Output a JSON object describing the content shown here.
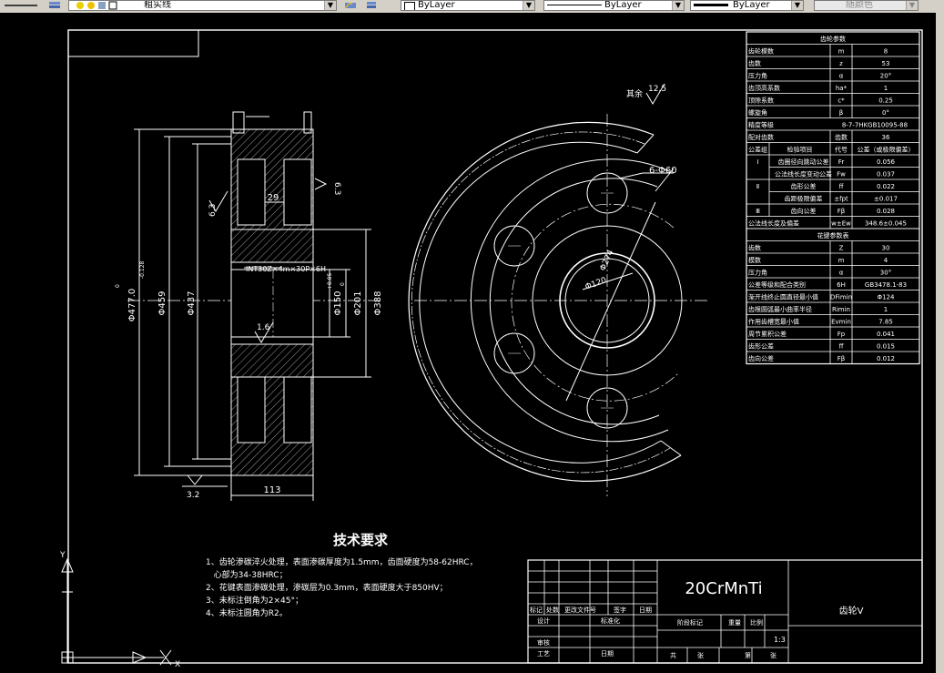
{
  "toolbar": {
    "layer_name": "粗实线",
    "color_combo": "ByLayer",
    "linetype_combo": "ByLayer",
    "lineweight_combo": "ByLayer",
    "plotstyle_combo": "随颜色"
  },
  "drawing": {
    "left_view": {
      "dims_vertical": [
        "Φ477.0",
        "Φ459",
        "Φ437",
        "Φ150",
        "Φ201",
        "Φ388"
      ],
      "tol_upper": "0",
      "tol_lower": "-0.128",
      "tol150_upper": "+0.05",
      "tol150_lower": "0",
      "spline_label": "INT30Z×4m×30P×6H",
      "width_dim": "113",
      "slot_dim": "29",
      "rough_63a": "6.3",
      "rough_63b": "6.3",
      "rough_16": "1.6",
      "rough_32": "3.2"
    },
    "right_view": {
      "holes_label": "6-Φ60",
      "bore_label": "Φ120",
      "pcd_label": "Φ274",
      "rest_label": "其余",
      "rest_rough": "12.5"
    },
    "params_table": {
      "title": "齿轮参数",
      "rows": [
        [
          "齿轮模数",
          "m",
          "8"
        ],
        [
          "齿数",
          "z",
          "53"
        ],
        [
          "压力角",
          "α",
          "20°"
        ],
        [
          "齿顶高系数",
          "ha*",
          "1"
        ],
        [
          "顶隙系数",
          "c*",
          "0.25"
        ],
        [
          "螺旋角",
          "β",
          "0°"
        ],
        [
          "精度等级",
          "",
          "8-7-7HKGB10095-88"
        ],
        [
          "配对齿数",
          "齿数",
          "36"
        ]
      ],
      "check_header": [
        "公差组",
        "检验项目",
        "代号",
        "公差（或极限偏差）"
      ],
      "check_rows": [
        [
          "Ⅰ",
          "齿圈径向跳动公差",
          "Fr",
          "0.056"
        ],
        [
          "",
          "公法线长度变动公差",
          "Fw",
          "0.037"
        ],
        [
          "Ⅱ",
          "齿形公差",
          "ff",
          "0.022"
        ],
        [
          "",
          "齿距极限偏差",
          "±fpt",
          "±0.017"
        ],
        [
          "Ⅲ",
          "齿向公差",
          "Fβ",
          "0.028"
        ],
        [
          "公法线长度及偏差",
          "",
          "w±Ew",
          "348.6±0.045"
        ]
      ],
      "spline_title": "花键参数表",
      "spline_rows": [
        [
          "齿数",
          "Z",
          "30"
        ],
        [
          "模数",
          "m",
          "4"
        ],
        [
          "压力角",
          "α",
          "30°"
        ],
        [
          "公差等级和配合类别",
          "6H",
          "GB3478.1-83"
        ],
        [
          "渐开线终止圆直径最小值",
          "DFimin",
          "Φ124"
        ],
        [
          "齿根圆弧最小曲率半径",
          "Rimin",
          "1"
        ],
        [
          "作用齿槽宽最小值",
          "Evmin",
          "7.85"
        ],
        [
          "周节累积公差",
          "Fp",
          "0.041"
        ],
        [
          "齿形公差",
          "ff",
          "0.015"
        ],
        [
          "齿向公差",
          "Fβ",
          "0.012"
        ]
      ]
    },
    "tech_req": {
      "title": "技术要求",
      "lines": [
        "1、齿轮渗碳淬火处理，表面渗碳厚度为1.5mm，齿面硬度为58-62HRC，",
        "   心部为34-38HRC；",
        "2、花键表面渗碳处理，渗碳层为0.3mm，表面硬度大于850HV；",
        "3、未标注倒角为2×45°；",
        "4、未标注圆角为R2。"
      ]
    },
    "title_block": {
      "material": "20CrMnTi",
      "part_name": "齿轮V",
      "scale": "1:3",
      "labels": [
        "标记",
        "处数",
        "更改文件号",
        "签字",
        "日期",
        "设计",
        "标准化",
        "审核",
        "工艺",
        "日期",
        "阶段标记",
        "重量",
        "比例",
        "共",
        "张",
        "第",
        "张"
      ]
    },
    "ucs": {
      "x_label": "X",
      "y_label": "Y"
    }
  }
}
